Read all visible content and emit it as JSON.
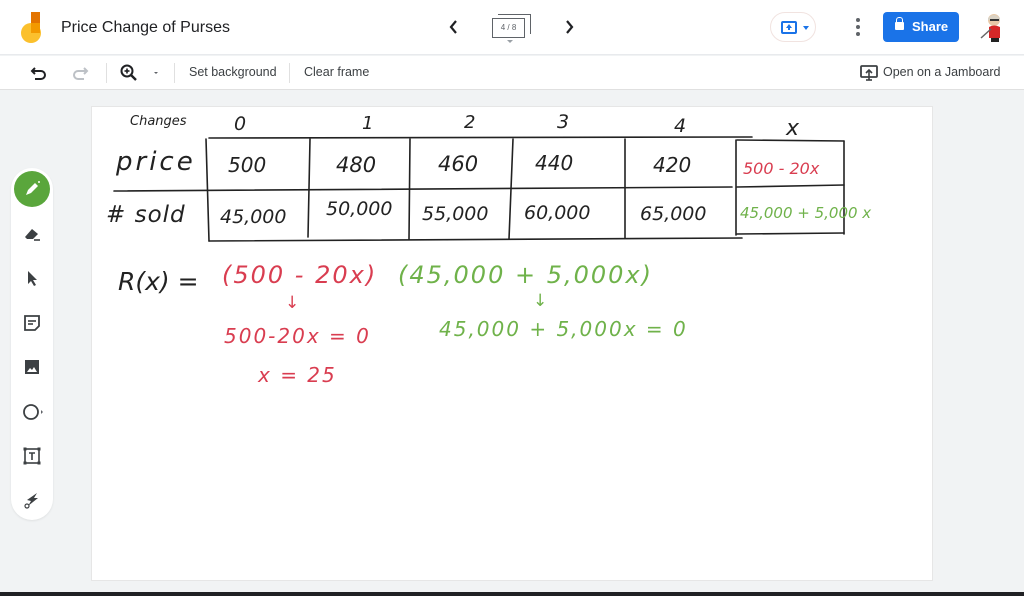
{
  "header": {
    "app_logo": "jamboard-logo",
    "title": "Price Change of Purses",
    "prev_icon": "chevron-left-icon",
    "next_icon": "chevron-right-icon",
    "frame_indicator": "4 / 8",
    "present_icon": "present-icon",
    "more_icon": "more-vert-icon",
    "share_label": "Share",
    "share_icon": "lock-icon",
    "avatar": "user-avatar"
  },
  "toolbar": {
    "undo_icon": "undo-icon",
    "redo_icon": "redo-icon",
    "zoom_icon": "zoom-in-icon",
    "set_background_label": "Set background",
    "clear_frame_label": "Clear frame",
    "open_on_jamboard_label": "Open on a Jamboard",
    "open_icon": "cast-to-jamboard-icon"
  },
  "tools": [
    {
      "name": "pen",
      "icon": "pen-icon",
      "active": true
    },
    {
      "name": "eraser",
      "icon": "eraser-icon",
      "active": false
    },
    {
      "name": "select",
      "icon": "cursor-icon",
      "active": false
    },
    {
      "name": "sticky-note",
      "icon": "sticky-note-icon",
      "active": false
    },
    {
      "name": "image",
      "icon": "image-icon",
      "active": false
    },
    {
      "name": "shape",
      "icon": "circle-icon",
      "active": false
    },
    {
      "name": "text-box",
      "icon": "text-box-icon",
      "active": false
    },
    {
      "name": "laser",
      "icon": "laser-icon",
      "active": false
    }
  ],
  "board": {
    "table": {
      "corner_label": "Changes",
      "headers": [
        "0",
        "1",
        "2",
        "3",
        "4",
        "x"
      ],
      "rows": [
        {
          "label": "price",
          "values": [
            "500",
            "480",
            "460",
            "440",
            "420"
          ],
          "expression": "500 - 20x"
        },
        {
          "label": "# sold",
          "values": [
            "45,000",
            "50,000",
            "55,000",
            "60,000",
            "65,000"
          ],
          "expression": "45,000 + 5,000 x"
        }
      ]
    },
    "revenue_label": "R(x) =",
    "factor_price": "(500 - 20x)",
    "factor_sold": "(45,000 + 5,000x)",
    "arrow": "↓",
    "eq_price": "500-20x = 0",
    "eq_sold": "45,000 + 5,000x = 0",
    "solution": "x = 25",
    "colors": {
      "ink_black": "#222222",
      "ink_red": "#d93d50",
      "ink_green": "#6fb24a"
    }
  }
}
